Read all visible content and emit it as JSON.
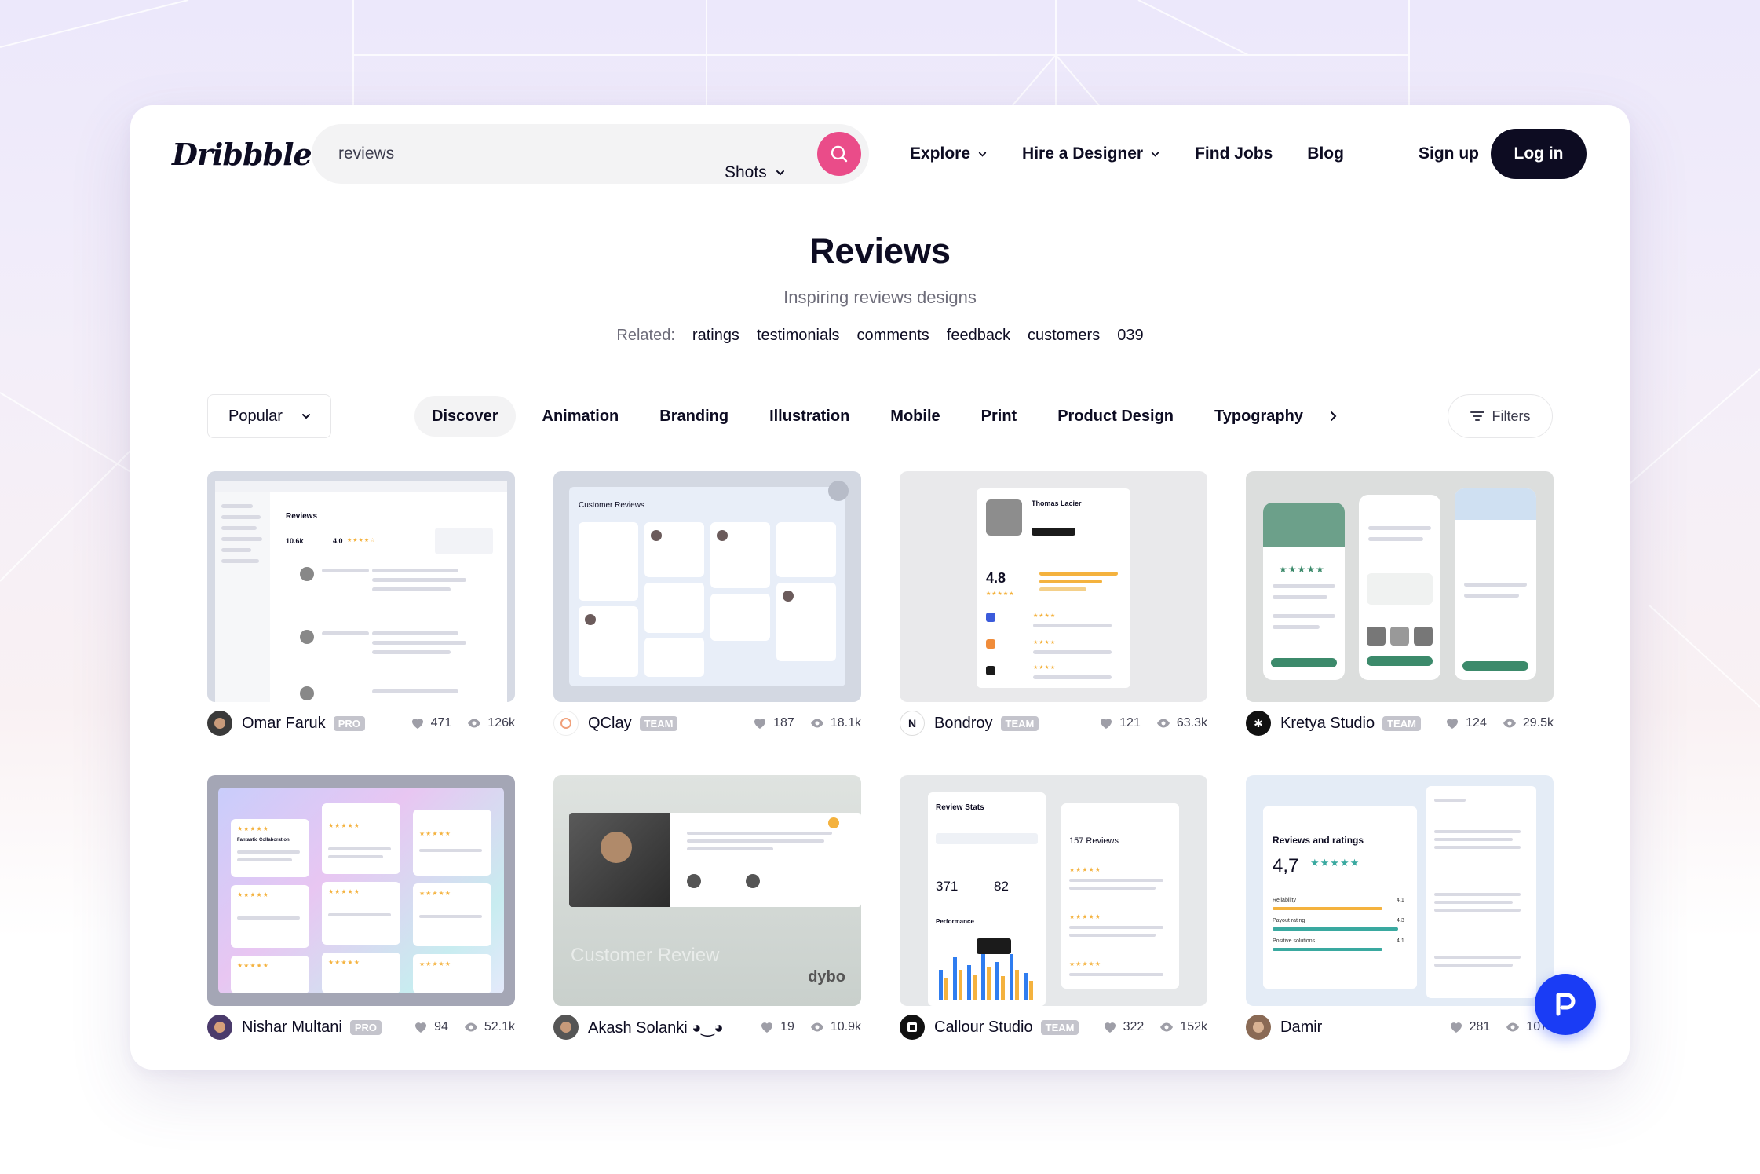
{
  "header": {
    "logo": "Dribbble",
    "search_value": "reviews",
    "search_scope": "Shots",
    "nav": [
      "Explore",
      "Hire a Designer",
      "Find Jobs",
      "Blog"
    ],
    "signup": "Sign up",
    "login": "Log in"
  },
  "hero": {
    "title": "Reviews",
    "subtitle": "Inspiring reviews designs",
    "related_label": "Related:",
    "related": [
      "ratings",
      "testimonials",
      "comments",
      "feedback",
      "customers",
      "039"
    ]
  },
  "filters": {
    "sort": "Popular",
    "categories": [
      "Discover",
      "Animation",
      "Branding",
      "Illustration",
      "Mobile",
      "Print",
      "Product Design",
      "Typography"
    ],
    "active_category": "Discover",
    "filters_label": "Filters"
  },
  "shots": [
    {
      "author": "Omar Faruk",
      "badge": "PRO",
      "likes": "471",
      "views": "126k"
    },
    {
      "author": "QClay",
      "badge": "TEAM",
      "likes": "187",
      "views": "18.1k"
    },
    {
      "author": "Bondroy",
      "badge": "TEAM",
      "likes": "121",
      "views": "63.3k"
    },
    {
      "author": "Kretya Studio",
      "badge": "TEAM",
      "likes": "124",
      "views": "29.5k"
    },
    {
      "author": "Nishar Multani",
      "badge": "PRO",
      "likes": "94",
      "views": "52.1k"
    },
    {
      "author": "Akash Solanki ◕‿◕",
      "badge": "",
      "likes": "19",
      "views": "10.9k"
    },
    {
      "author": "Callour Studio",
      "badge": "TEAM",
      "likes": "322",
      "views": "152k"
    },
    {
      "author": "Damir",
      "badge": "",
      "likes": "281",
      "views": "107k"
    }
  ],
  "thumbs": {
    "t1_title": "Reviews",
    "t1_num1": "10.6k",
    "t1_num2": "4.0",
    "t2_title": "Customer Reviews",
    "t3_name": "Thomas Lacier",
    "t3_score": "4.8",
    "t5_label": "Fantastic Collaboration",
    "t6_caption": "Customer Review",
    "t6_brand": "dybo",
    "t7_title": "Review Stats",
    "t7_num1": "371",
    "t7_num2": "82",
    "t7_perf": "Performance",
    "t7_count": "157 Reviews",
    "t8_title": "Reviews and ratings",
    "t8_score": "4,7",
    "t8_r1": "Reliability",
    "t8_r2": "Payout rating",
    "t8_r3": "Positive solutions",
    "t8_v1": "4.1",
    "t8_v2": "4.3",
    "t8_v3": "4.1"
  },
  "colors": {
    "accent": "#ea4c89",
    "brand_dark": "#0d0c22",
    "fab": "#1a3cf5"
  }
}
